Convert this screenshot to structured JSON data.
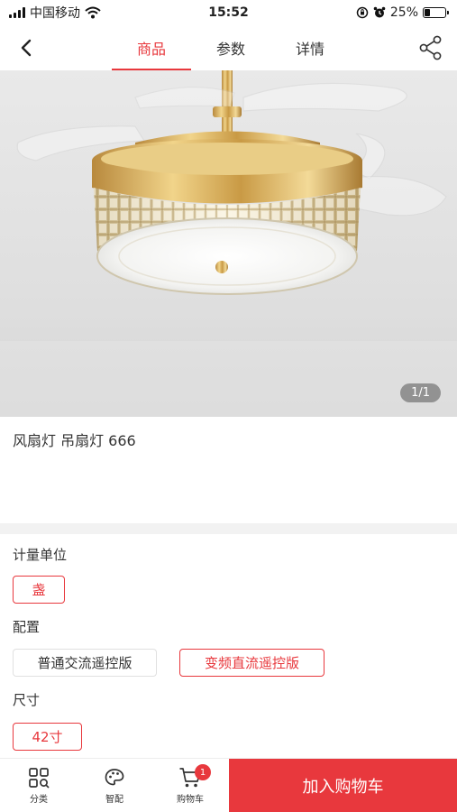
{
  "status_bar": {
    "carrier": "中国移动",
    "time": "15:52",
    "battery_percent": "25%",
    "battery_level": 0.25,
    "icons": [
      "signal-icon",
      "wifi-icon",
      "orientation-lock-icon",
      "alarm-icon",
      "battery-icon"
    ]
  },
  "header": {
    "tabs": [
      {
        "label": "商品",
        "active": true
      },
      {
        "label": "参数",
        "active": false
      },
      {
        "label": "详情",
        "active": false
      }
    ],
    "icons": [
      "back-arrow-icon",
      "share-icon"
    ]
  },
  "gallery": {
    "pager": "1/1"
  },
  "product": {
    "title": "风扇灯 吊扇灯 666"
  },
  "specs": {
    "unit": {
      "label": "计量单位",
      "options": [
        {
          "label": "盏",
          "selected": true
        }
      ]
    },
    "config": {
      "label": "配置",
      "options": [
        {
          "label": "普通交流遥控版",
          "selected": false
        },
        {
          "label": "变频直流遥控版",
          "selected": true
        }
      ]
    },
    "size": {
      "label": "尺寸",
      "options": [
        {
          "label": "42寸",
          "selected": true
        }
      ]
    }
  },
  "bottom_bar": {
    "category": "分类",
    "smart_match": "智配",
    "cart": "购物车",
    "cart_badge": "1",
    "add_to_cart": "加入购物车"
  },
  "colors": {
    "accent": "#e8383d",
    "divider": "#f2f2f2"
  }
}
